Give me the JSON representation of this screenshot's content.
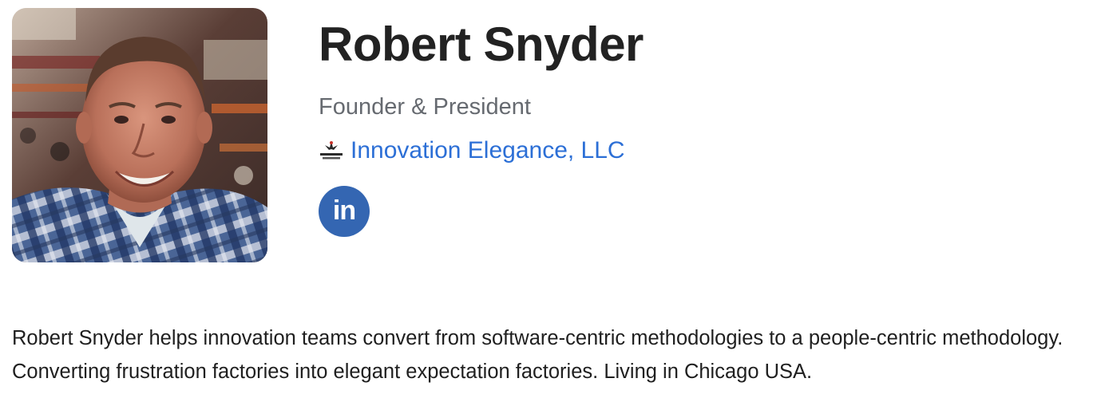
{
  "profile": {
    "name": "Robert Snyder",
    "title": "Founder & President",
    "company": {
      "name": "Innovation Elegance, LLC",
      "logo_icon": "innovation-elegance-logo",
      "color": "#2c6fd6"
    },
    "social": {
      "linkedin": {
        "icon": "linkedin-icon",
        "glyph": "in",
        "color": "#3466b2"
      }
    },
    "bio": "Robert Snyder helps innovation teams convert from software-centric methodologies to a people-centric methodology. Converting frustration factories into elegant expectation factories. Living in Chicago USA."
  }
}
